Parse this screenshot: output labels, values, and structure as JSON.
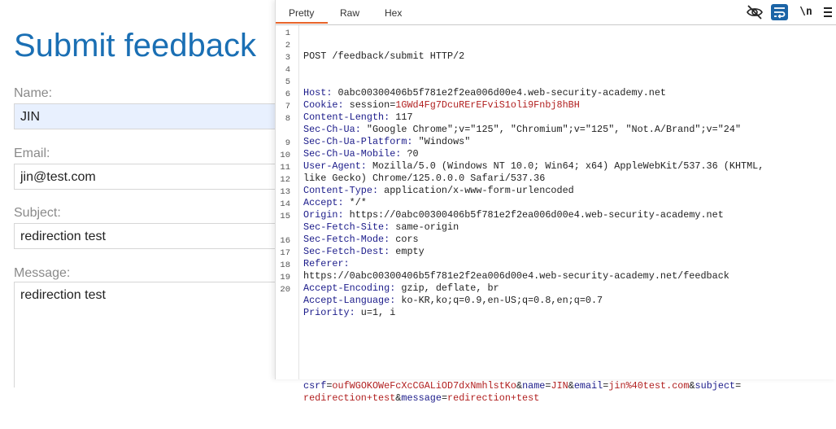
{
  "form": {
    "title": "Submit feedback",
    "name_label": "Name:",
    "name_value": "JIN",
    "email_label": "Email:",
    "email_value": "jin@test.com",
    "subject_label": "Subject:",
    "subject_value": "redirection test",
    "message_label": "Message:",
    "message_value": "redirection test"
  },
  "panel": {
    "tabs": {
      "pretty": "Pretty",
      "raw": "Raw",
      "hex": "Hex"
    },
    "newline_label": "\\n",
    "icons": [
      "eye-off-icon",
      "wrap-icon",
      "menu-icon"
    ],
    "accent_color": "#e8642a",
    "active_tool_color": "#1b64a6",
    "line_numbers": [
      "1",
      "2",
      "3",
      "4",
      "5",
      "6",
      "7",
      "8",
      "",
      "9",
      "10",
      "11",
      "12",
      "13",
      "14",
      "15",
      "",
      "16",
      "17",
      "18",
      "19",
      "20"
    ]
  },
  "request": {
    "request_line": "POST /feedback/submit HTTP/2",
    "headers": [
      {
        "key": "Host",
        "value": " 0abc00300406b5f781e2f2ea006d00e4.web-security-academy.net"
      },
      {
        "key": "Cookie",
        "value": " session="
      },
      {
        "key": "Content-Length",
        "value": " 117"
      },
      {
        "key": "Sec-Ch-Ua",
        "value": " \"Google Chrome\";v=\"125\", \"Chromium\";v=\"125\", \"Not.A/Brand\";v=\"24\""
      },
      {
        "key": "Sec-Ch-Ua-Platform",
        "value": " \"Windows\""
      },
      {
        "key": "Sec-Ch-Ua-Mobile",
        "value": " ?0"
      },
      {
        "key": "User-Agent",
        "value": " Mozilla/5.0 (Windows NT 10.0; Win64; x64) AppleWebKit/537.36 (KHTML,"
      },
      {
        "key": "",
        "value": "like Gecko) Chrome/125.0.0.0 Safari/537.36"
      },
      {
        "key": "Content-Type",
        "value": " application/x-www-form-urlencoded"
      },
      {
        "key": "Accept",
        "value": " */*"
      },
      {
        "key": "Origin",
        "value": " https://0abc00300406b5f781e2f2ea006d00e4.web-security-academy.net"
      },
      {
        "key": "Sec-Fetch-Site",
        "value": " same-origin"
      },
      {
        "key": "Sec-Fetch-Mode",
        "value": " cors"
      },
      {
        "key": "Sec-Fetch-Dest",
        "value": " empty"
      },
      {
        "key": "Referer",
        "value": ""
      },
      {
        "key": "",
        "value": "https://0abc00300406b5f781e2f2ea006d00e4.web-security-academy.net/feedback"
      },
      {
        "key": "Accept-Encoding",
        "value": " gzip, deflate, br"
      },
      {
        "key": "Accept-Language",
        "value": " ko-KR,ko;q=0.9,en-US;q=0.8,en;q=0.7"
      },
      {
        "key": "Priority",
        "value": " u=1, i"
      }
    ],
    "session_cookie": "1GWd4Fg7DcuRErEFviS1oli9Fnbj8hBH",
    "body_params": [
      {
        "key": "csrf",
        "value": "oufWGOKOWeFcXcCGALiOD7dxNmhlstKo"
      },
      {
        "key": "name",
        "value": "JIN"
      },
      {
        "key": "email",
        "value": "jin%40test.com"
      },
      {
        "key": "subject",
        "value": "redirection+test"
      },
      {
        "key": "message",
        "value": "redirection+test"
      }
    ]
  }
}
